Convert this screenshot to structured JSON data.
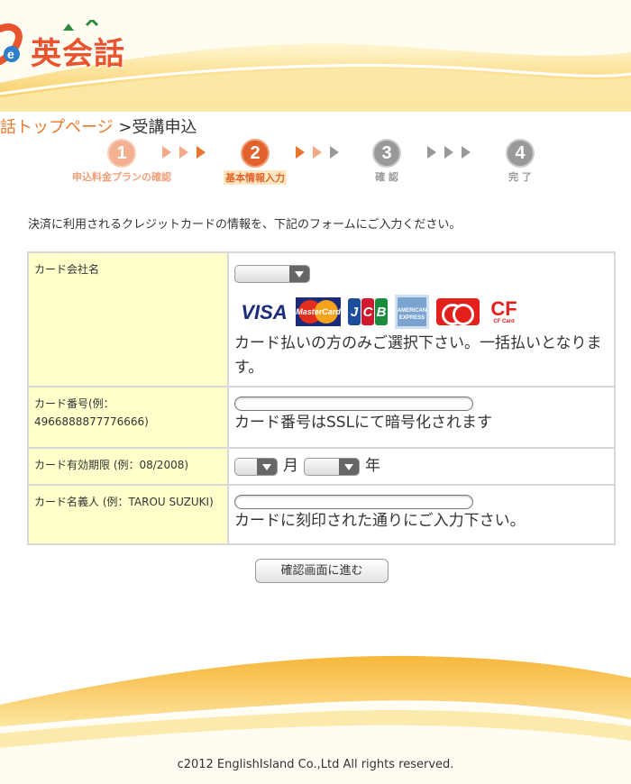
{
  "header": {
    "logo_text": "英会話"
  },
  "breadcrumb": {
    "home_label": "話トップページ",
    "separator": ">",
    "current_label": "受講申込"
  },
  "steps": [
    {
      "number": "1",
      "label": "申込料金プランの確認",
      "state": "done"
    },
    {
      "number": "2",
      "label": "基本情報入力",
      "state": "active"
    },
    {
      "number": "3",
      "label": "確 認",
      "state": "todo"
    },
    {
      "number": "4",
      "label": "完 了",
      "state": "todo"
    }
  ],
  "instruction": "決済に利用されるクレジットカードの情報を、下記のフォームにご入力ください。",
  "form": {
    "card_company": {
      "label": "カード会社名",
      "selected": "",
      "brands": [
        "VISA",
        "MasterCard",
        "JCB",
        "AMERICAN EXPRESS",
        "Diners Club",
        "CF Card"
      ],
      "note": "カード払いの方のみご選択下さい。一括払いとなります。"
    },
    "card_number": {
      "label": "カード番号(例：4966888877776666)",
      "value": "",
      "note": "カード番号はSSLにて暗号化されます"
    },
    "expiry": {
      "label": "カード有効期限 (例：08/2008)",
      "month_value": "",
      "month_unit": "月",
      "year_value": "",
      "year_unit": "年"
    },
    "holder": {
      "label": "カード名義人 (例：TAROU SUZUKI)",
      "value": "",
      "note": "カードに刻印された通りにご入力下さい。"
    }
  },
  "submit_label": "確認画面に進む",
  "footer": {
    "copyright": "c2012 EnglishIsland Co.,Ltd All rights reserved."
  },
  "colors": {
    "accent_orange": "#e0632d",
    "label_bg": "#ffffcc",
    "border": "#d8d8d8"
  }
}
